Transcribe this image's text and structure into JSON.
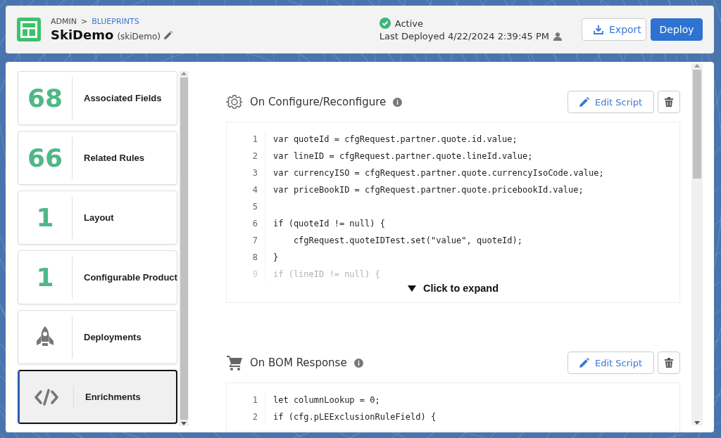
{
  "header": {
    "breadcrumb": [
      {
        "label": "ADMIN",
        "link": false
      },
      {
        "label": ">",
        "link": false
      },
      {
        "label": "BLUEPRINTS",
        "link": true
      }
    ],
    "title": "SkiDemo",
    "api_name": "(skiDemo)",
    "status": "Active",
    "last_deployed": "Last Deployed 4/22/2024 2:39:45 PM",
    "buttons": [
      {
        "label": "Export",
        "kind": "outline"
      },
      {
        "label": "Deploy",
        "kind": "brand"
      }
    ]
  },
  "sidebar": {
    "items": [
      {
        "kind": "count",
        "count": "68",
        "label": "Associated Fields",
        "selected": false
      },
      {
        "kind": "count",
        "count": "66",
        "label": "Related Rules",
        "selected": false
      },
      {
        "kind": "count",
        "count": "1",
        "label": "Layout",
        "selected": false
      },
      {
        "kind": "count",
        "count": "1",
        "label": "Configurable Product",
        "selected": false
      },
      {
        "kind": "rocket",
        "label": "Deployments",
        "selected": false
      },
      {
        "kind": "code",
        "label": "Enrichments",
        "selected": true
      }
    ]
  },
  "scripts": [
    {
      "kind": "gear",
      "title": "On Configure/Reconfigure",
      "edit_label": "Edit Script",
      "expand_label": "Click to expand",
      "lines": [
        {
          "number": "1",
          "code": "var quoteId = cfgRequest.partner.quote.id.value;"
        },
        {
          "number": "2",
          "code": "var lineID = cfgRequest.partner.quote.lineId.value;"
        },
        {
          "number": "3",
          "code": "var currencyISO = cfgRequest.partner.quote.currencyIsoCode.value;"
        },
        {
          "number": "4",
          "code": "var priceBookID = cfgRequest.partner.quote.pricebookId.value;"
        },
        {
          "number": "5"
        },
        {
          "number": "6",
          "code": "if (quoteId != null) {"
        },
        {
          "number": "7",
          "code": "    cfgRequest.quoteIDTest.set(\"value\", quoteId);"
        },
        {
          "number": "8",
          "code": "}"
        },
        {
          "number": "9",
          "code": "if (lineID != null) {"
        }
      ]
    },
    {
      "kind": "cart",
      "title": "On BOM Response",
      "edit_label": "Edit Script",
      "lines": [
        {
          "number": "1",
          "code": "let columnLookup = 0;"
        },
        {
          "number": "2",
          "code": "if (cfg.pLEExclusionRuleField) {"
        }
      ]
    }
  ]
}
